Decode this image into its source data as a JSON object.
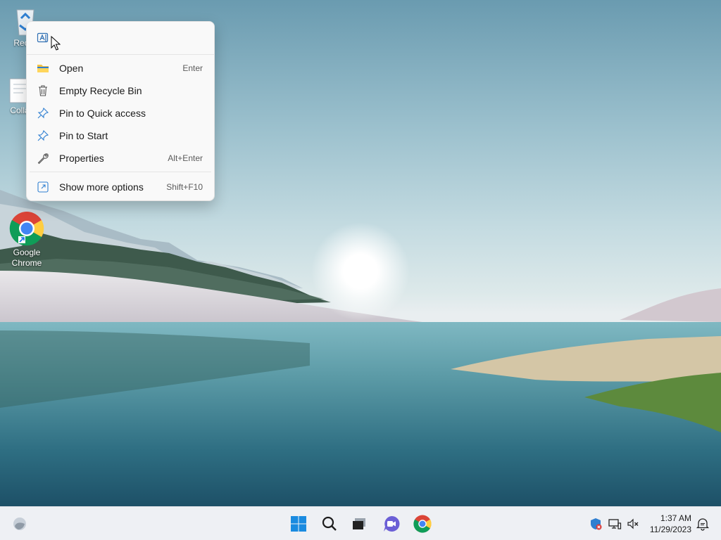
{
  "desktop": {
    "icons": [
      {
        "label": "Recyc",
        "icon": "recycle-bin-icon"
      },
      {
        "label": "Colla",
        "icon": "document-icon"
      },
      {
        "label_line1": "Google",
        "label_line2": "Chrome",
        "icon": "chrome-icon"
      }
    ]
  },
  "context_menu": {
    "top_action_icon": "rename-icon",
    "items": [
      {
        "label": "Open",
        "shortcut": "Enter",
        "icon": "folder-icon"
      },
      {
        "label": "Empty Recycle Bin",
        "shortcut": "",
        "icon": "trash-icon"
      },
      {
        "label": "Pin to Quick access",
        "shortcut": "",
        "icon": "pin-icon"
      },
      {
        "label": "Pin to Start",
        "shortcut": "",
        "icon": "pin-icon"
      },
      {
        "label": "Properties",
        "shortcut": "Alt+Enter",
        "icon": "wrench-icon"
      },
      {
        "label": "Show more options",
        "shortcut": "Shift+F10",
        "icon": "show-more-icon"
      }
    ]
  },
  "taskbar": {
    "widgets_icon": "weather-icon",
    "pinned": [
      "start-icon",
      "search-icon",
      "task-view-icon",
      "teams-chat-icon",
      "chrome-icon"
    ],
    "tray": [
      "security-icon",
      "network-icon",
      "volume-muted-icon"
    ],
    "clock": {
      "time": "1:37 AM",
      "date": "11/29/2023"
    },
    "notification_icon": "notification-icon"
  },
  "colors": {
    "accent": "#0067c0",
    "menu_bg": "#f9f9f9",
    "taskbar_bg": "#eef0f4"
  }
}
